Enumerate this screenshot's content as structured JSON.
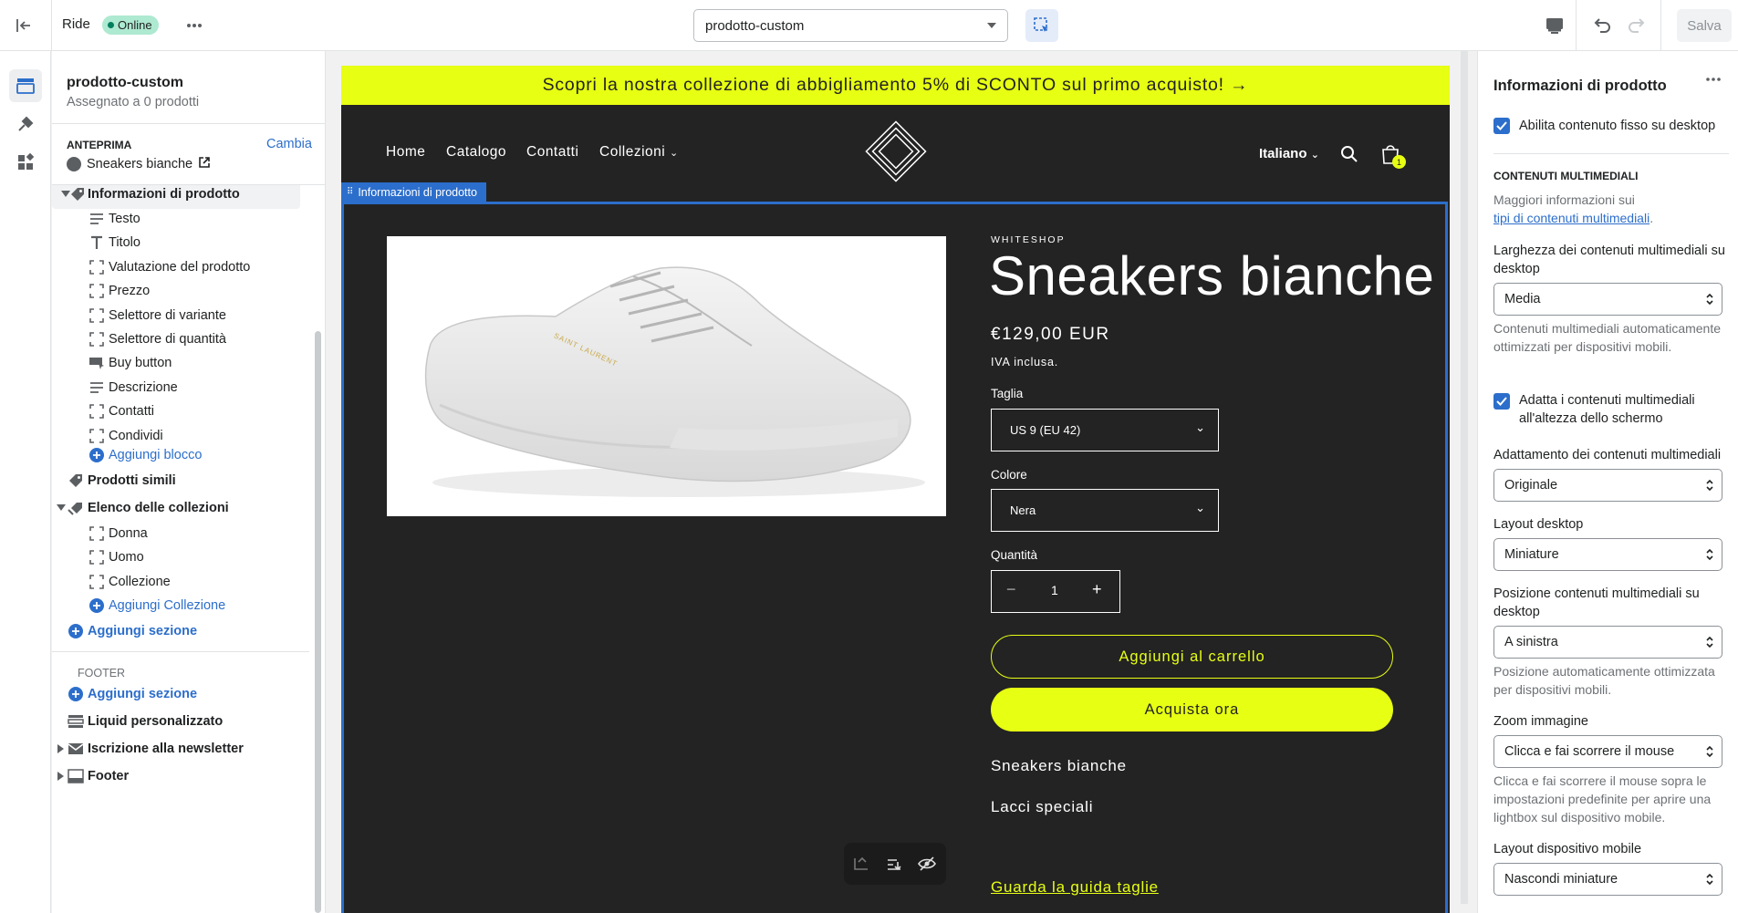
{
  "topbar": {
    "exit_label": "Exit",
    "store_name": "Ride",
    "status": "Online",
    "template_value": "prodotto-custom",
    "save_label": "Salva"
  },
  "left": {
    "template_title": "prodotto-custom",
    "assigned": "Assegnato a 0 prodotti",
    "preview_label": "ANTEPRIMA",
    "change_label": "Cambia",
    "preview_product": "Sneakers bianche",
    "section_info": "Informazioni di prodotto",
    "blocks": [
      "Testo",
      "Titolo",
      "Valutazione del prodotto",
      "Prezzo",
      "Selettore di variante",
      "Selettore di quantità",
      "Buy button",
      "Descrizione",
      "Contatti",
      "Condividi"
    ],
    "add_block": "Aggiungi blocco",
    "similar": "Prodotti simili",
    "collections_list": "Elenco delle collezioni",
    "collections": [
      "Donna",
      "Uomo",
      "Collezione"
    ],
    "add_collection": "Aggiungi Collezione",
    "add_section": "Aggiungi sezione",
    "footer_heading": "FOOTER",
    "footer_add_section": "Aggiungi sezione",
    "footer_items": [
      "Liquid personalizzato",
      "Iscrizione alla newsletter",
      "Footer"
    ]
  },
  "store": {
    "announcement": "Scopri la nostra collezione di abbigliamento 5% di SCONTO sul primo acquisto! →",
    "nav": [
      "Home",
      "Catalogo",
      "Contatti",
      "Collezioni"
    ],
    "language": "Italiano",
    "cart_count": "1",
    "section_tag": "Informazioni di prodotto",
    "vendor": "WHITESHOP",
    "product_title": "Sneakers bianche",
    "price": "€129,00 EUR",
    "tax_note": "IVA inclusa.",
    "size_label": "Taglia",
    "size_value": "US 9 (EU 42)",
    "color_label": "Colore",
    "color_value": "Nera",
    "qty_label": "Quantità",
    "qty_value": "1",
    "add_to_cart": "Aggiungi al carrello",
    "buy_now": "Acquista ora",
    "desc_1": "Sneakers bianche",
    "desc_2": "Lacci speciali",
    "size_guide": "Guarda la guida taglie",
    "shoe_brand": "SAINT LAURENT"
  },
  "right": {
    "title": "Informazioni di prodotto",
    "sticky_label": "Abilita contenuto fisso su desktop",
    "media_heading": "CONTENUTI MULTIMEDIALI",
    "media_info": "Maggiori informazioni sui",
    "media_link": "tipi di contenuti multimediali",
    "media_link_tail": ".",
    "width_label": "Larghezza dei contenuti multimediali su desktop",
    "width_value": "Media",
    "width_help": "Contenuti multimediali automaticamente ottimizzati per dispositivi mobili.",
    "fit_height_label": "Adatta i contenuti multimediali all'altezza dello schermo",
    "fit_label": "Adattamento dei contenuti multimediali",
    "fit_value": "Originale",
    "layout_label": "Layout desktop",
    "layout_value": "Miniature",
    "position_label": "Posizione contenuti multimediali su desktop",
    "position_value": "A sinistra",
    "position_help": "Posizione automaticamente ottimizzata per dispositivi mobili.",
    "zoom_label": "Zoom immagine",
    "zoom_value": "Clicca e fai scorrere il mouse",
    "zoom_help": "Clicca e fai scorrere il mouse sopra le impostazioni predefinite per aprire una lightbox sul dispositivo mobile.",
    "mobile_label": "Layout dispositivo mobile",
    "mobile_value": "Nascondi miniature"
  },
  "colors": {
    "accent": "#2c6ecb",
    "highlight": "#e7ff13",
    "store_bg": "#232323",
    "online": "#aee9d1"
  }
}
